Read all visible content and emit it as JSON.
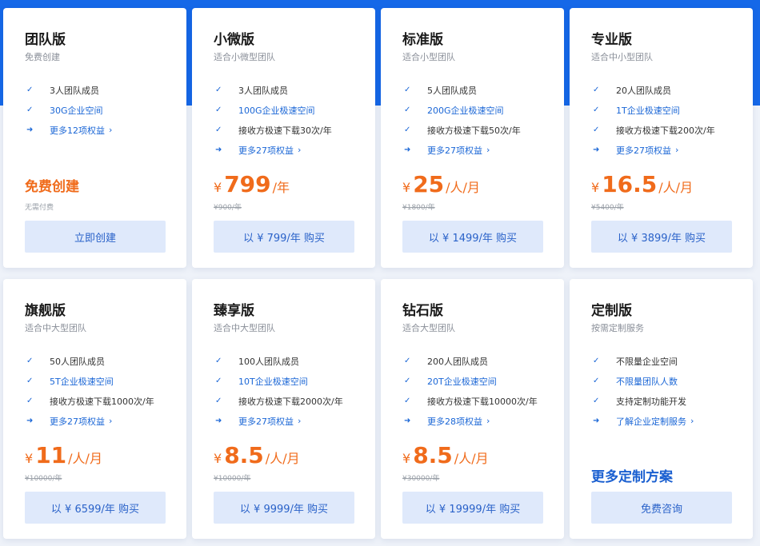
{
  "plans": [
    {
      "id": "team",
      "name": "团队版",
      "subtitle": "免费创建",
      "features": [
        {
          "type": "check",
          "text": "3人团队成员"
        },
        {
          "type": "link",
          "text": "30G企业空间"
        },
        {
          "type": "more",
          "text": "更多12项权益"
        }
      ],
      "free_title": "免费创建",
      "note": "无需付费",
      "button": "立即创建"
    },
    {
      "id": "mini",
      "name": "小微版",
      "subtitle": "适合小微型团队",
      "features": [
        {
          "type": "check",
          "text": "3人团队成员"
        },
        {
          "type": "link",
          "text": "100G企业极速空间"
        },
        {
          "type": "check",
          "text": "接收方极速下载30次/年"
        },
        {
          "type": "more",
          "text": "更多27项权益"
        }
      ],
      "currency": "¥",
      "price": "799",
      "unit": "/年",
      "original": "¥900/年",
      "button": "以 ¥ 799/年 购买"
    },
    {
      "id": "standard",
      "name": "标准版",
      "subtitle": "适合小型团队",
      "features": [
        {
          "type": "check",
          "text": "5人团队成员"
        },
        {
          "type": "link",
          "text": "200G企业极速空间"
        },
        {
          "type": "check",
          "text": "接收方极速下载50次/年"
        },
        {
          "type": "more",
          "text": "更多27项权益"
        }
      ],
      "currency": "¥",
      "price": "25",
      "unit": "/人/月",
      "original": "¥1800/年",
      "button": "以 ¥ 1499/年 购买"
    },
    {
      "id": "pro",
      "name": "专业版",
      "subtitle": "适合中小型团队",
      "features": [
        {
          "type": "check",
          "text": "20人团队成员"
        },
        {
          "type": "link",
          "text": "1T企业极速空间"
        },
        {
          "type": "check",
          "text": "接收方极速下载200次/年"
        },
        {
          "type": "more",
          "text": "更多27项权益"
        }
      ],
      "currency": "¥",
      "price": "16.5",
      "unit": "/人/月",
      "original": "¥5400/年",
      "button": "以 ¥ 3899/年 购买"
    },
    {
      "id": "flagship",
      "name": "旗舰版",
      "subtitle": "适合中大型团队",
      "features": [
        {
          "type": "check",
          "text": "50人团队成员"
        },
        {
          "type": "link",
          "text": "5T企业极速空间"
        },
        {
          "type": "check",
          "text": "接收方极速下载1000次/年"
        },
        {
          "type": "more",
          "text": "更多27项权益"
        }
      ],
      "currency": "¥",
      "price": "11",
      "unit": "/人/月",
      "original": "¥10000/年",
      "button": "以 ¥ 6599/年 购买"
    },
    {
      "id": "premium",
      "name": "臻享版",
      "subtitle": "适合中大型团队",
      "features": [
        {
          "type": "check",
          "text": "100人团队成员"
        },
        {
          "type": "link",
          "text": "10T企业极速空间"
        },
        {
          "type": "check",
          "text": "接收方极速下载2000次/年"
        },
        {
          "type": "more",
          "text": "更多27项权益"
        }
      ],
      "currency": "¥",
      "price": "8.5",
      "unit": "/人/月",
      "original": "¥10000/年",
      "button": "以 ¥ 9999/年 购买"
    },
    {
      "id": "diamond",
      "name": "钻石版",
      "subtitle": "适合大型团队",
      "features": [
        {
          "type": "check",
          "text": "200人团队成员"
        },
        {
          "type": "link",
          "text": "20T企业极速空间"
        },
        {
          "type": "check",
          "text": "接收方极速下载10000次/年"
        },
        {
          "type": "more",
          "text": "更多28项权益"
        }
      ],
      "currency": "¥",
      "price": "8.5",
      "unit": "/人/月",
      "original": "¥30000/年",
      "button": "以 ¥ 19999/年 购买"
    },
    {
      "id": "custom",
      "name": "定制版",
      "subtitle": "按需定制服务",
      "features": [
        {
          "type": "check",
          "text": "不限量企业空间"
        },
        {
          "type": "link",
          "text": "不限量团队人数"
        },
        {
          "type": "check",
          "text": "支持定制功能开发"
        },
        {
          "type": "more",
          "text": "了解企业定制服务"
        }
      ],
      "custom_title": "更多定制方案",
      "button": "免费咨询"
    }
  ],
  "icons": {
    "check": "check-icon",
    "more": "arrow-right-icon",
    "chevron": "chevron-right-icon"
  },
  "colors": {
    "header_blue": "#1568e8",
    "price_orange": "#f06b1b",
    "link_blue": "#1a66d6",
    "button_bg": "#dfe9fb"
  }
}
